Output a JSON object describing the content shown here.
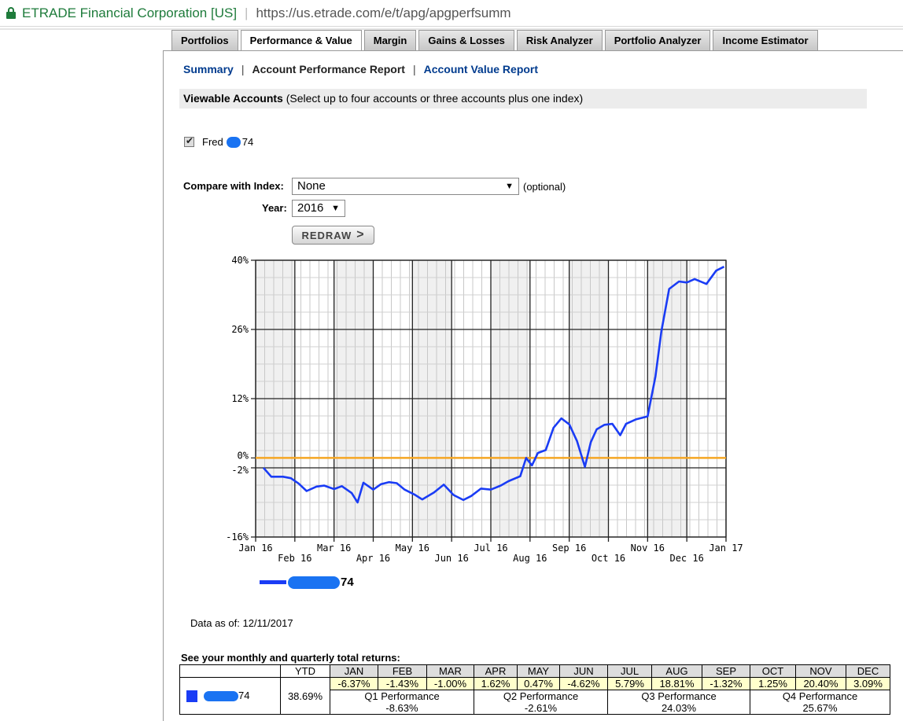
{
  "browser": {
    "site_name": "ETRADE Financial Corporation [US]",
    "url": "https://us.etrade.com/e/t/apg/apgperfsumm"
  },
  "tabs": [
    "Portfolios",
    "Performance & Value",
    "Margin",
    "Gains & Losses",
    "Risk Analyzer",
    "Portfolio Analyzer",
    "Income Estimator"
  ],
  "active_tab": "Performance & Value",
  "subnav": {
    "summary": "Summary",
    "sep": "|",
    "current": "Account Performance Report",
    "value_report": "Account Value Report"
  },
  "viewable": {
    "label": "Viewable Accounts",
    "hint": "(Select up to four accounts or three accounts plus one index)"
  },
  "account": {
    "name": "Fred",
    "suffix": "74",
    "checked": true
  },
  "compare": {
    "label": "Compare with Index:",
    "selected": "None",
    "optional": "(optional)"
  },
  "year": {
    "label": "Year:",
    "selected": "2016"
  },
  "redraw_label": "REDRAW",
  "chart_data": {
    "type": "line",
    "y_tick_labels": [
      "40%",
      "26%",
      "12%",
      "0%",
      "-2%",
      "-16%"
    ],
    "y_ticks": [
      40,
      26,
      12,
      0,
      -2,
      -16
    ],
    "ylim": [
      -16,
      40
    ],
    "x_ticks_top": [
      "Jan 16",
      "Mar 16",
      "May 16",
      "Jul 16",
      "Sep 16",
      "Nov 16",
      "Jan 17"
    ],
    "x_ticks_bottom": [
      "Feb 16",
      "Apr 16",
      "Jun 16",
      "Aug 16",
      "Oct 16",
      "Dec 16"
    ],
    "grid": true,
    "reference_line": {
      "y": 0,
      "color": "#f5a623"
    },
    "series": [
      {
        "color": "#1a3cf5",
        "x": [
          0.2,
          0.4,
          0.7,
          0.9,
          1.1,
          1.3,
          1.55,
          1.75,
          2.0,
          2.2,
          2.45,
          2.6,
          2.75,
          3.0,
          3.2,
          3.4,
          3.6,
          3.8,
          4.05,
          4.25,
          4.55,
          4.8,
          5.05,
          5.3,
          5.5,
          5.75,
          6.0,
          6.25,
          6.45,
          6.75,
          6.9,
          7.05,
          7.2,
          7.4,
          7.6,
          7.8,
          8.0,
          8.2,
          8.4,
          8.55,
          8.7,
          8.9,
          9.1,
          9.3,
          9.45,
          9.7,
          10.0,
          10.2,
          10.35,
          10.55,
          10.8,
          11.0,
          11.2,
          11.5,
          11.75,
          11.95
        ],
        "values": [
          -2.0,
          -3.8,
          -3.8,
          -4.1,
          -5.2,
          -6.7,
          -5.8,
          -5.6,
          -6.3,
          -5.7,
          -7.1,
          -9.0,
          -5.0,
          -6.4,
          -5.3,
          -4.9,
          -5.1,
          -6.4,
          -7.4,
          -8.4,
          -7.0,
          -5.4,
          -7.5,
          -8.5,
          -7.7,
          -6.2,
          -6.4,
          -5.6,
          -4.7,
          -3.7,
          0.0,
          -1.5,
          1.0,
          1.6,
          6.1,
          8.0,
          6.8,
          3.4,
          -1.8,
          3.2,
          5.8,
          6.7,
          6.9,
          4.6,
          6.9,
          7.8,
          8.4,
          16.5,
          25.6,
          34.2,
          35.7,
          35.5,
          36.2,
          35.2,
          37.9,
          38.7
        ]
      }
    ],
    "legend_suffix": "74"
  },
  "data_as_of": "Data as of: 12/11/2017",
  "returns": {
    "title": "See your monthly and quarterly total returns:",
    "ytd_header": "YTD",
    "months": [
      "JAN",
      "FEB",
      "MAR",
      "APR",
      "MAY",
      "JUN",
      "JUL",
      "AUG",
      "SEP",
      "OCT",
      "NOV",
      "DEC"
    ],
    "monthly": [
      "-6.37%",
      "-1.43%",
      "-1.00%",
      "1.62%",
      "0.47%",
      "-4.62%",
      "5.79%",
      "18.81%",
      "-1.32%",
      "1.25%",
      "20.40%",
      "3.09%"
    ],
    "account_suffix": "74",
    "ytd": "38.69%",
    "quarters": [
      {
        "label": "Q1 Performance",
        "value": "-8.63%"
      },
      {
        "label": "Q2 Performance",
        "value": "-2.61%"
      },
      {
        "label": "Q3 Performance",
        "value": "24.03%"
      },
      {
        "label": "Q4 Performance",
        "value": "25.67%"
      }
    ]
  }
}
